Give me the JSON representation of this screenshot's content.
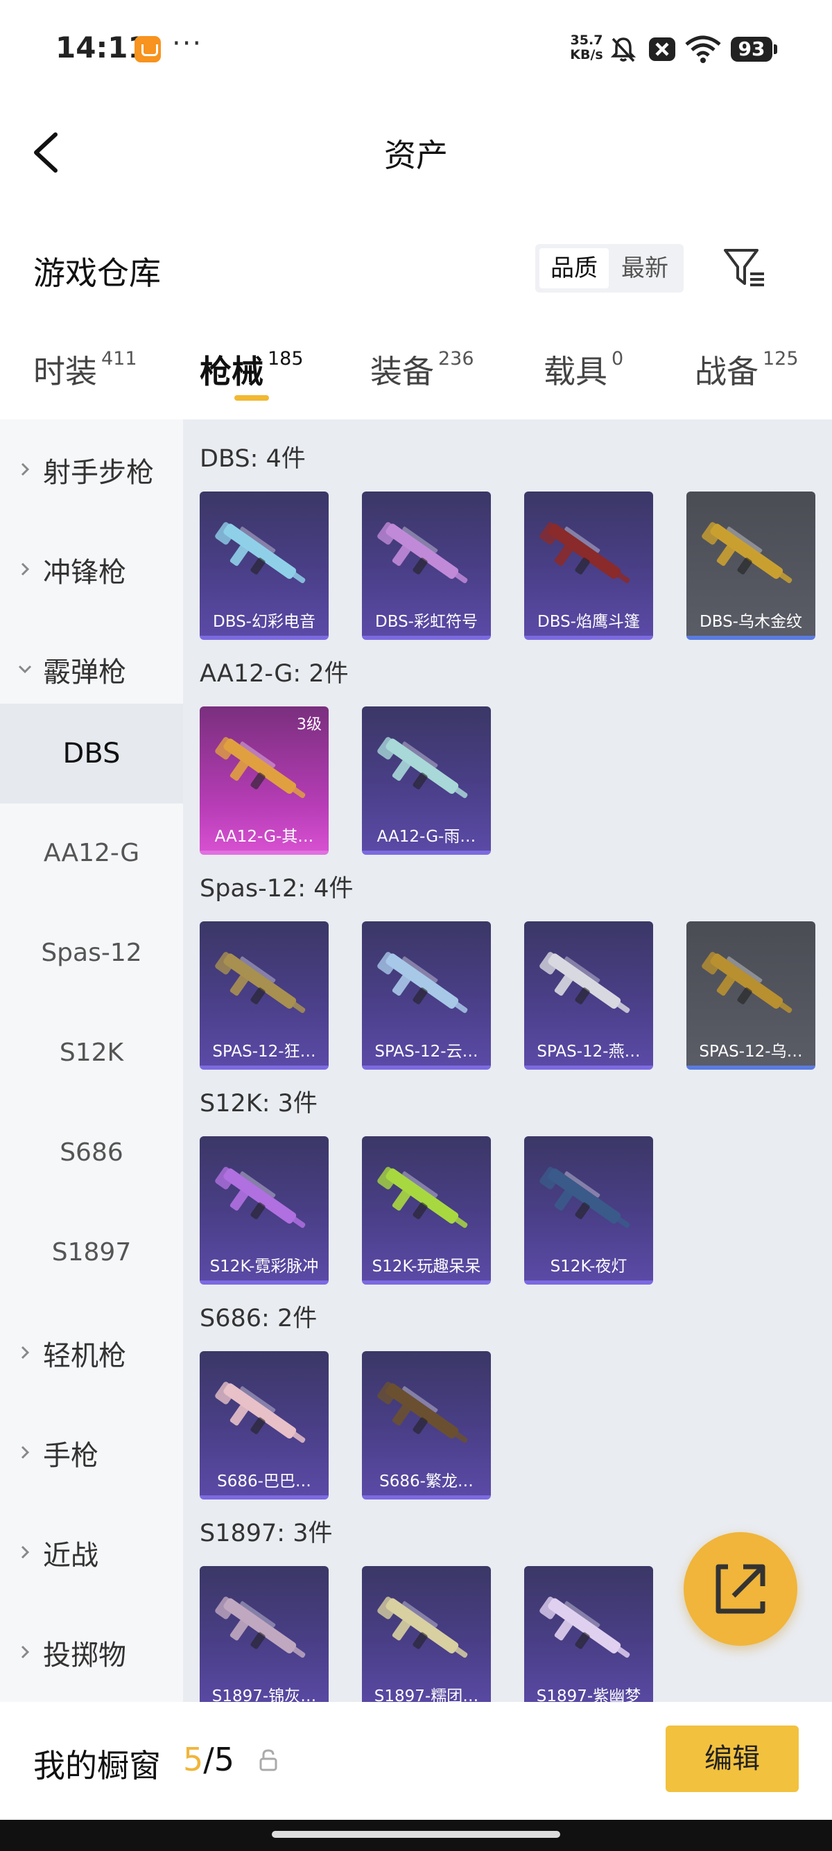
{
  "status_bar": {
    "time": "14:11",
    "more": "···",
    "net_speed_value": "35.7",
    "net_speed_unit": "KB/s",
    "battery": "93",
    "icons": [
      "app-notification-icon",
      "mute-bell-icon",
      "close-box-icon",
      "wifi-icon",
      "battery-icon"
    ]
  },
  "header": {
    "title": "资产",
    "back_icon": "back-arrow-icon"
  },
  "section": {
    "title": "游戏仓库",
    "sort_options": [
      "品质",
      "最新"
    ],
    "sort_selected": "品质",
    "filter_icon": "filter-icon"
  },
  "tabs": [
    {
      "label": "时装",
      "count": "411"
    },
    {
      "label": "枪械",
      "count": "185",
      "active": true
    },
    {
      "label": "装备",
      "count": "236"
    },
    {
      "label": "载具",
      "count": "0"
    },
    {
      "label": "战备",
      "count": "125"
    }
  ],
  "sidebar": {
    "categories": [
      {
        "label": "射手步枪",
        "expanded": false
      },
      {
        "label": "冲锋枪",
        "expanded": false
      },
      {
        "label": "霰弹枪",
        "expanded": true,
        "subitems": [
          "DBS",
          "AA12-G",
          "Spas-12",
          "S12K",
          "S686",
          "S1897"
        ],
        "active_sub": "DBS"
      },
      {
        "label": "轻机枪",
        "expanded": false
      },
      {
        "label": "手枪",
        "expanded": false
      },
      {
        "label": "近战",
        "expanded": false
      },
      {
        "label": "投掷物",
        "expanded": false
      }
    ]
  },
  "groups": [
    {
      "title": "DBS: 4件",
      "items": [
        {
          "name": "DBS-幻彩电音",
          "rarity": "purple",
          "gun_color": "#8fd0e8"
        },
        {
          "name": "DBS-彩虹符号",
          "rarity": "purple",
          "gun_color": "#c08ad8"
        },
        {
          "name": "DBS-焰鹰斗篷",
          "rarity": "purple",
          "gun_color": "#8a2a2a"
        },
        {
          "name": "DBS-乌木金纹",
          "rarity": "gray",
          "gun_color": "#c9a030"
        }
      ]
    },
    {
      "title": "AA12-G: 2件",
      "items": [
        {
          "name": "AA12-G-其…",
          "rarity": "pink",
          "level": "3级",
          "gun_color": "#e0a040"
        },
        {
          "name": "AA12-G-雨…",
          "rarity": "purple",
          "gun_color": "#a8d8d8"
        }
      ]
    },
    {
      "title": "Spas-12: 4件",
      "items": [
        {
          "name": "SPAS-12-狂…",
          "rarity": "purple",
          "gun_color": "#a89050"
        },
        {
          "name": "SPAS-12-云…",
          "rarity": "purple",
          "gun_color": "#a8c8e8"
        },
        {
          "name": "SPAS-12-燕…",
          "rarity": "purple",
          "gun_color": "#d8d8e0"
        },
        {
          "name": "SPAS-12-乌…",
          "rarity": "gray",
          "gun_color": "#b89030"
        }
      ]
    },
    {
      "title": "S12K: 3件",
      "items": [
        {
          "name": "S12K-霓彩脉冲",
          "rarity": "purple",
          "gun_color": "#b070e0"
        },
        {
          "name": "S12K-玩趣呆呆",
          "rarity": "purple",
          "gun_color": "#a8d840"
        },
        {
          "name": "S12K-夜灯",
          "rarity": "purple",
          "gun_color": "#3a5a8a"
        }
      ]
    },
    {
      "title": "S686: 2件",
      "items": [
        {
          "name": "S686-巴巴…",
          "rarity": "purple",
          "gun_color": "#e8c0c8"
        },
        {
          "name": "S686-繁龙…",
          "rarity": "purple",
          "gun_color": "#6a5030"
        }
      ]
    },
    {
      "title": "S1897: 3件",
      "items": [
        {
          "name": "S1897-锦灰…",
          "rarity": "purple",
          "gun_color": "#c0a8c0"
        },
        {
          "name": "S1897-糯团…",
          "rarity": "purple",
          "gun_color": "#d8d0a0"
        },
        {
          "name": "S1897-紫幽梦",
          "rarity": "purple",
          "gun_color": "#e0d0f0"
        }
      ]
    }
  ],
  "fab": {
    "icon": "share-icon"
  },
  "bottom_bar": {
    "label": "我的橱窗",
    "current": "5",
    "separator": "/",
    "total": "5",
    "lock_icon": "lock-icon",
    "edit_label": "编辑"
  },
  "colors": {
    "accent": "#f2b833",
    "card_purple": "#4a3f88",
    "card_gray": "#5a5c66",
    "card_pink": "#b83db7",
    "sidebar_bg": "#f6f7f9",
    "content_bg": "#e9ecf1"
  }
}
